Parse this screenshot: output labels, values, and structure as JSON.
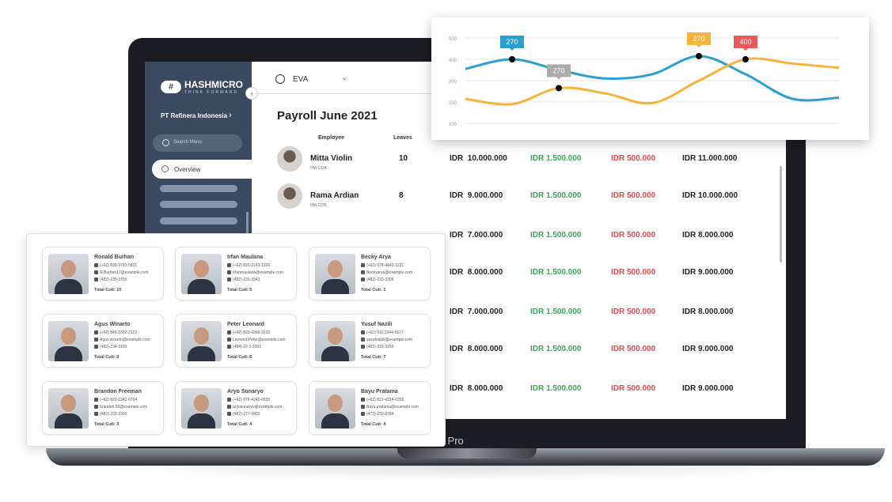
{
  "laptop": {
    "bezel_label": "acbook Pro"
  },
  "sidebar": {
    "brand": "HASHMICRO",
    "tagline": "THINK FORWARD",
    "company": "PT Refinera Indonesia",
    "search_placeholder": "Search Menu",
    "active_item": "Overview"
  },
  "header": {
    "module": "EVA"
  },
  "payroll": {
    "title": "Payroll June 2021",
    "columns": [
      "Employee",
      "Leaves"
    ],
    "employees": [
      {
        "name": "Mitta Violin",
        "id": "HM-1234",
        "leaves": "10"
      },
      {
        "name": "Rama Ardian",
        "id": "HM-1235",
        "leaves": "8"
      }
    ],
    "rows": [
      [
        "IDR  10.000.000",
        "IDR 1.500.000",
        "IDR 500.000",
        "IDR 11.000.000"
      ],
      [
        "IDR  9.000.000",
        "IDR 1.500.000",
        "IDR 500.000",
        "IDR 10.000.000"
      ],
      [
        "IDR  7.000.000",
        "IDR 1.500.000",
        "IDR 500.000",
        "IDR 8.000.000"
      ],
      [
        "IDR  8.000.000",
        "IDR 1.500.000",
        "IDR 500.000",
        "IDR 9.000.000"
      ],
      [
        "IDR  7.000.000",
        "IDR 1.500.000",
        "IDR 500.000",
        "IDR 8.000.000"
      ],
      [
        "IDR  8.000.000",
        "IDR 1.500.000",
        "IDR 500.000",
        "IDR 9.000.000"
      ],
      [
        "IDR  8.000.000",
        "IDR 1.500.000",
        "IDR 500.000",
        "IDR 9.000.000"
      ]
    ],
    "colors": {
      "allowance": "#3aa55a",
      "deduction": "#e0484f"
    }
  },
  "chart_data": {
    "type": "line",
    "ylim": [
      100,
      500
    ],
    "yticks": [
      "100",
      "200",
      "300",
      "400",
      "500"
    ],
    "grid": true,
    "series": [
      {
        "color": "#2a9fd0",
        "values": [
          355,
          400,
          350,
          310,
          330,
          415,
          330,
          215,
          220
        ]
      },
      {
        "color": "#f7b23b",
        "values": [
          215,
          190,
          265,
          240,
          195,
          300,
          400,
          380,
          360
        ]
      }
    ],
    "annotations": [
      {
        "series": 0,
        "index": 1,
        "label": "270",
        "color": "#2a9fd0"
      },
      {
        "series": 1,
        "index": 2,
        "label": "270",
        "color": "#a9abad"
      },
      {
        "series": 0,
        "index": 5,
        "label": "270",
        "color": "#f7b23b"
      },
      {
        "series": 1,
        "index": 6,
        "label": "400",
        "color": "#e85a5a"
      }
    ]
  },
  "cards": [
    {
      "name": "Ronald Burhan",
      "mobile": "(+62) 835-3793-5821",
      "email": "R.Burhan17@example.com",
      "phone": "(482)-235-3793",
      "cuti": "Total Cuti: 10"
    },
    {
      "name": "Irfan Maulana",
      "mobile": "(+62) 822-2143-1326",
      "email": "Irfanmaulana@example.com",
      "phone": "(482)-231-3343",
      "cuti": "Total Cuti: 5"
    },
    {
      "name": "Becky Arya",
      "mobile": "(+62) 878-4443-1231",
      "email": "Beckyarya@example.com",
      "phone": "(482)-222-3395",
      "cuti": "Total Cuti: 1"
    },
    {
      "name": "Agus Winarto",
      "mobile": "(+62) 845-2332-2122",
      "email": "Agus.winarto@example.com",
      "phone": "(482)-234-3193",
      "cuti": "Total Cuti: 9"
    },
    {
      "name": "Peter Leonard",
      "mobile": "(+62) 823-4366-3232",
      "email": "Leonard.Peter@example.com",
      "phone": "(484)-22 3-3393",
      "cuti": "Total Cuti: 6"
    },
    {
      "name": "Yusuf Nazili",
      "mobile": "(+62) 811-2344-5677",
      "email": "yusufnazili@example.com",
      "phone": "(482)-333-3293",
      "cuti": "Total Cuti: 7"
    },
    {
      "name": "Brandon Freeman",
      "mobile": "(+62) 823-2342-6764",
      "email": "brandon.55@example.com",
      "phone": "(482)-222-3393",
      "cuti": "Total Cuti: 3"
    },
    {
      "name": "Aryo Sunaryo",
      "mobile": "(+62) 876-4242-6535",
      "email": "aryosunaryo@example.com",
      "phone": "(482)-277-3493",
      "cuti": "Total Cuti: 4"
    },
    {
      "name": "Bayu Pratama",
      "mobile": "(+62) 821-4324-6356",
      "email": "Bayu.pratama@example.com",
      "phone": "(472)-233-3394",
      "cuti": "Total Cuti: 4"
    }
  ]
}
